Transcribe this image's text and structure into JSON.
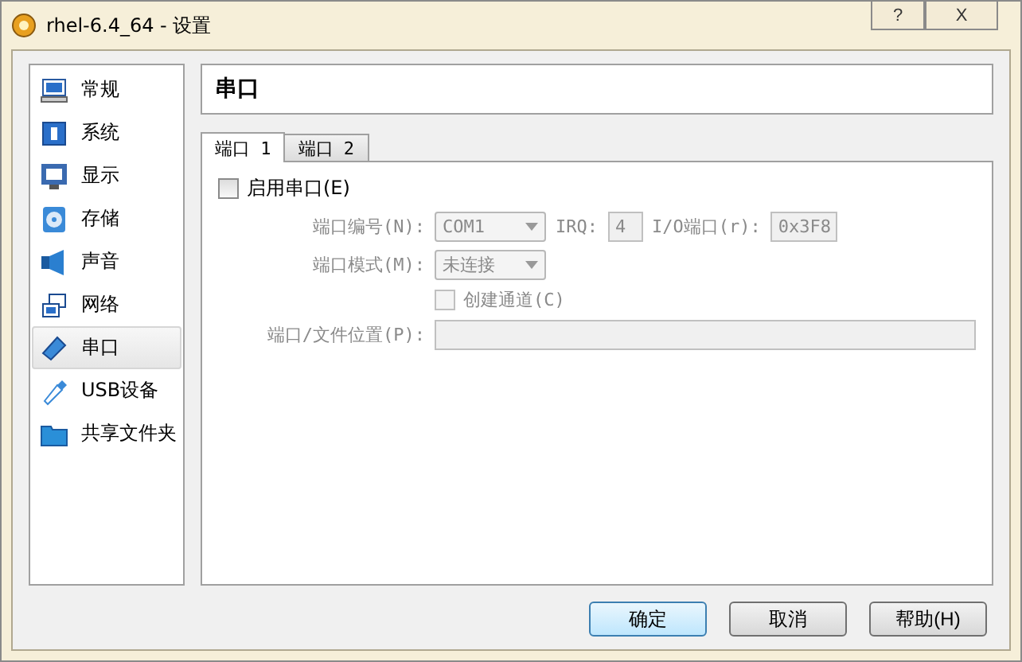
{
  "window": {
    "title": "rhel-6.4_64 - 设置",
    "help_button": "?",
    "close_button": "X"
  },
  "sidebar": {
    "items": [
      {
        "label": "常规",
        "selected": false
      },
      {
        "label": "系统",
        "selected": false
      },
      {
        "label": "显示",
        "selected": false
      },
      {
        "label": "存储",
        "selected": false
      },
      {
        "label": "声音",
        "selected": false
      },
      {
        "label": "网络",
        "selected": false
      },
      {
        "label": "串口",
        "selected": true
      },
      {
        "label": "USB设备",
        "selected": false
      },
      {
        "label": "共享文件夹",
        "selected": false
      }
    ]
  },
  "page_title": "串口",
  "tabs": [
    {
      "label": "端口 1",
      "selected": true
    },
    {
      "label": "端口 2",
      "selected": false
    }
  ],
  "enable": {
    "label": "启用串口(E)",
    "checked": false
  },
  "port_number": {
    "label": "端口编号(N):",
    "value": "COM1",
    "disabled": true
  },
  "irq": {
    "label": "IRQ:",
    "value": "4",
    "disabled": true
  },
  "io_port": {
    "label": "I/O端口(r):",
    "value": "0x3F8",
    "disabled": true
  },
  "port_mode": {
    "label": "端口模式(M):",
    "value": "未连接",
    "disabled": true
  },
  "create_pipe": {
    "label": "创建通道(C)",
    "checked": false,
    "disabled": true
  },
  "path": {
    "label": "端口/文件位置(P):",
    "disabled": true
  },
  "buttons": [
    {
      "label": "确定",
      "default": true
    },
    {
      "label": "取消",
      "default": false
    },
    {
      "label": "帮助(H)",
      "default": false
    }
  ]
}
